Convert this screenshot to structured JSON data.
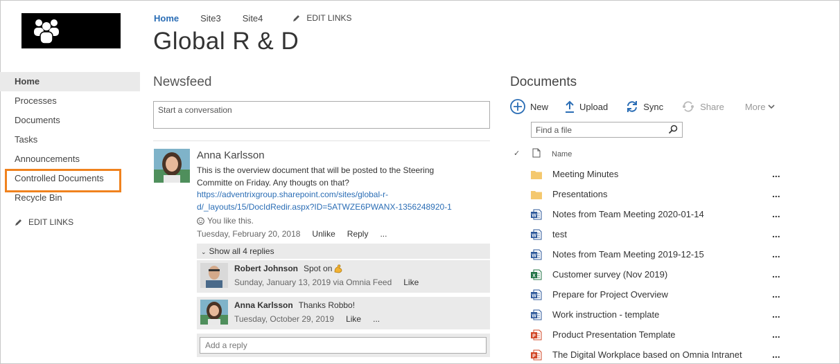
{
  "topnav": {
    "items": [
      "Home",
      "Site3",
      "Site4"
    ],
    "edit_links": "EDIT LINKS"
  },
  "page_title": "Global R & D",
  "leftnav": {
    "items": [
      "Home",
      "Processes",
      "Documents",
      "Tasks",
      "Announcements",
      "Controlled Documents",
      "Recycle Bin"
    ],
    "edit_links": "EDIT LINKS"
  },
  "newsfeed": {
    "title": "Newsfeed",
    "input_placeholder": "Start a conversation",
    "post": {
      "author": "Anna Karlsson",
      "text": "This is the overview document that will be posted to the Steering Committe on Friday. Any thougts on that?",
      "link": "https://adventrixgroup.sharepoint.com/sites/global-r-d/_layouts/15/DocIdRedir.aspx?ID=5ATWZE6PWANX-1356248920-1",
      "like_text": "You like this.",
      "date": "Tuesday, February 20, 2018",
      "actions": [
        "Unlike",
        "Reply",
        "..."
      ]
    },
    "replies_toggle": "Show all 4 replies",
    "replies": [
      {
        "author": "Robert Johnson",
        "text": "Spot on",
        "date": "Sunday, January 13, 2019 via Omnia Feed",
        "actions": [
          "Like"
        ]
      },
      {
        "author": "Anna Karlsson",
        "text": "Thanks Robbo!",
        "date": "Tuesday, October 29, 2019",
        "actions": [
          "Like",
          "..."
        ]
      }
    ],
    "add_reply_placeholder": "Add a reply"
  },
  "documents": {
    "title": "Documents",
    "toolbar": [
      "New",
      "Upload",
      "Sync",
      "Share",
      "More"
    ],
    "find_placeholder": "Find a file",
    "column_name": "Name",
    "files": [
      {
        "name": "Meeting Minutes",
        "type": "folder"
      },
      {
        "name": "Presentations",
        "type": "folder"
      },
      {
        "name": "Notes from Team Meeting 2020-01-14",
        "type": "word"
      },
      {
        "name": "test",
        "type": "word"
      },
      {
        "name": "Notes from Team Meeting 2019-12-15",
        "type": "word"
      },
      {
        "name": "Customer survey (Nov 2019)",
        "type": "excel"
      },
      {
        "name": "Prepare for Project Overview",
        "type": "word"
      },
      {
        "name": "Work instruction - template",
        "type": "word"
      },
      {
        "name": "Product Presentation Template",
        "type": "powerpoint"
      },
      {
        "name": "The Digital Workplace based on Omnia Intranet",
        "type": "powerpoint"
      }
    ],
    "row_menu": "..."
  },
  "colors": {
    "accent": "#2a6db5",
    "highlight": "#f0821e",
    "folder": "#f4c86e",
    "word": "#2b579a",
    "excel": "#217346",
    "powerpoint": "#d24726"
  }
}
